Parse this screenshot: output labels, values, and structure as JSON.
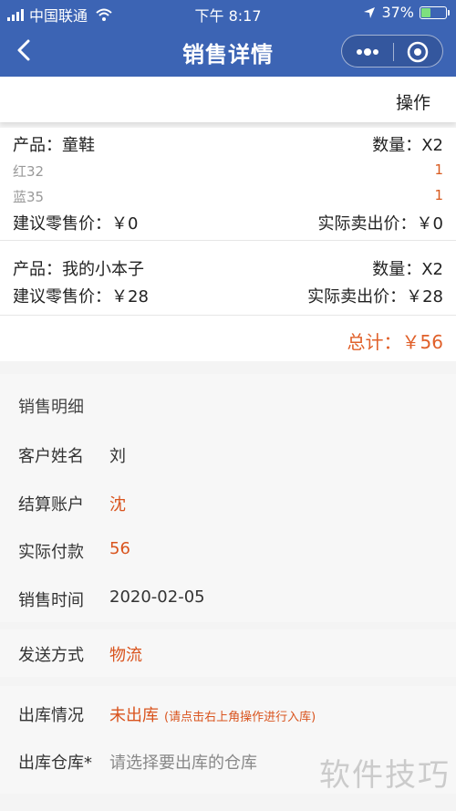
{
  "status_bar": {
    "carrier": "中国联通",
    "time": "下午 8:17",
    "battery": "37%"
  },
  "nav": {
    "title": "销售详情",
    "back_icon": "back-chevron-icon",
    "more_icon": "more-dots-icon",
    "close_icon": "target-circle-icon"
  },
  "toolbar": {
    "operate_label": "操作"
  },
  "products": [
    {
      "name": "产品：童鞋",
      "qty": "数量：X2",
      "variants": [
        {
          "label": "红32",
          "qty": "1"
        },
        {
          "label": "蓝35",
          "qty": "1"
        }
      ],
      "suggest_price": "建议零售价：￥0",
      "actual_price": "实际卖出价：￥0"
    },
    {
      "name": "产品：我的小本子",
      "qty": "数量：X2",
      "variants": [],
      "suggest_price": "建议零售价：￥28",
      "actual_price": "实际卖出价：￥28"
    }
  ],
  "total": "总计：￥56",
  "detail": {
    "title": "销售明细",
    "customer_label": "客户姓名",
    "customer_value": "刘",
    "account_label": "结算账户",
    "account_value": "沈",
    "paid_label": "实际付款",
    "paid_value": "56",
    "time_label": "销售时间",
    "time_value": "2020-02-05"
  },
  "shipping": {
    "label": "发送方式",
    "value": "物流"
  },
  "stock": {
    "status_label": "出库情况",
    "status_value": "未出库",
    "status_hint": "(请点击右上角操作进行入库)",
    "warehouse_label": "出库仓库*",
    "warehouse_placeholder": "请选择要出库的仓库"
  },
  "watermark": "软件技巧",
  "colors": {
    "nav_bg": "#3c64b4",
    "accent_orange": "#d9541e"
  }
}
